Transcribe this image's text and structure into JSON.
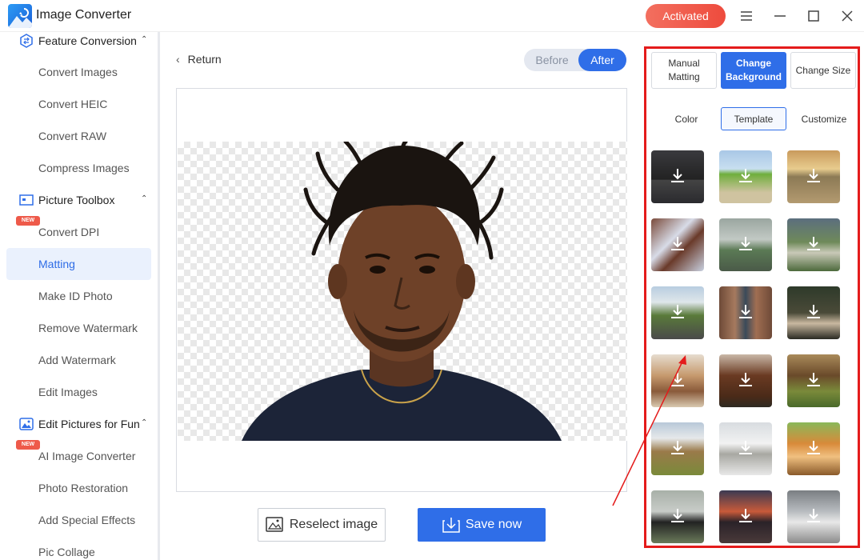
{
  "app": {
    "title": "Image Converter",
    "activated_label": "Activated"
  },
  "sidebar": {
    "sections": [
      {
        "label": "Feature Conversion",
        "icon": "convert-icon"
      },
      {
        "label": "Picture Toolbox",
        "icon": "toolbox-icon"
      },
      {
        "label": "Edit Pictures for Fun",
        "icon": "picture-fun-icon"
      }
    ],
    "items": [
      {
        "label": "Convert Images"
      },
      {
        "label": "Convert HEIC"
      },
      {
        "label": "Convert RAW"
      },
      {
        "label": "Compress Images"
      },
      {
        "label": "Convert DPI",
        "badge": "NEW"
      },
      {
        "label": "Matting",
        "active": true
      },
      {
        "label": "Make ID Photo"
      },
      {
        "label": "Remove Watermark"
      },
      {
        "label": "Add Watermark"
      },
      {
        "label": "Edit Images"
      },
      {
        "label": "AI Image Converter",
        "badge": "NEW"
      },
      {
        "label": "Photo Restoration"
      },
      {
        "label": "Add Special Effects"
      },
      {
        "label": "Pic Collage"
      }
    ]
  },
  "main": {
    "return_label": "Return",
    "toggle": {
      "before": "Before",
      "after": "After",
      "selected": "After"
    },
    "reselect_label": "Reselect image",
    "save_label": "Save now"
  },
  "panel": {
    "mode_tabs": [
      {
        "label": "Manual Matting"
      },
      {
        "label": "Change Background",
        "active": true
      },
      {
        "label": "Change Size"
      }
    ],
    "sub_tabs": [
      {
        "label": "Color"
      },
      {
        "label": "Template",
        "active": true
      },
      {
        "label": "Customize"
      }
    ],
    "templates": [
      "road-dark",
      "road-green-field",
      "road-sunset",
      "snowy-branches",
      "misty-road",
      "winding-road",
      "forest-road",
      "tree-bark",
      "deer",
      "camel",
      "highland-cattle",
      "horse-grazing",
      "wild-goat",
      "snow-leopard",
      "sleeping-fox",
      "buffalo",
      "car-sunset",
      "suv-mountain"
    ]
  },
  "colors": {
    "accent": "#2f6ee8",
    "activated": "#ee4b3d",
    "highlight_border": "#e41b1b"
  }
}
